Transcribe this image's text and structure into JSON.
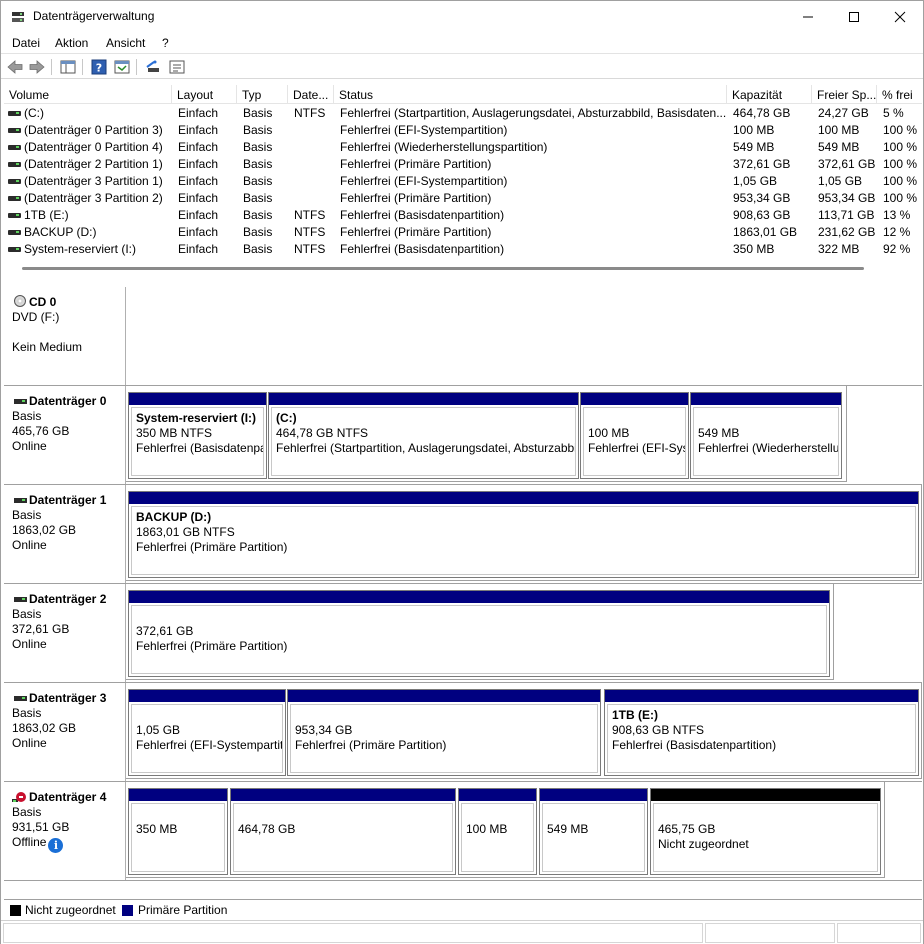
{
  "window": {
    "title": "Datenträgerverwaltung"
  },
  "menu": [
    {
      "label": "Datei"
    },
    {
      "label": "Aktion"
    },
    {
      "label": "Ansicht"
    },
    {
      "label": "?"
    }
  ],
  "toolbar": {
    "icons": [
      "back-arrow-icon",
      "forward-arrow-icon",
      "console-tree-icon",
      "help-icon",
      "action-pane-icon",
      "rescan-icon",
      "properties-icon"
    ]
  },
  "volume_table": {
    "headers": [
      "Volume",
      "Layout",
      "Typ",
      "Date...",
      "Status",
      "Kapazität",
      "Freier Sp...",
      "% frei"
    ],
    "rows": [
      {
        "volume": "(C:)",
        "layout": "Einfach",
        "typ": "Basis",
        "fs": "NTFS",
        "status": "Fehlerfrei (Startpartition, Auslagerungsdatei, Absturzabbild, Basisdaten...",
        "capacity": "464,78 GB",
        "free": "24,27 GB",
        "pct": "5 %"
      },
      {
        "volume": "(Datenträger 0 Partition 3)",
        "layout": "Einfach",
        "typ": "Basis",
        "fs": "",
        "status": "Fehlerfrei (EFI-Systempartition)",
        "capacity": "100 MB",
        "free": "100 MB",
        "pct": "100 %"
      },
      {
        "volume": "(Datenträger 0 Partition 4)",
        "layout": "Einfach",
        "typ": "Basis",
        "fs": "",
        "status": "Fehlerfrei (Wiederherstellungspartition)",
        "capacity": "549 MB",
        "free": "549 MB",
        "pct": "100 %"
      },
      {
        "volume": "(Datenträger 2 Partition 1)",
        "layout": "Einfach",
        "typ": "Basis",
        "fs": "",
        "status": "Fehlerfrei (Primäre Partition)",
        "capacity": "372,61 GB",
        "free": "372,61 GB",
        "pct": "100 %"
      },
      {
        "volume": "(Datenträger 3 Partition 1)",
        "layout": "Einfach",
        "typ": "Basis",
        "fs": "",
        "status": "Fehlerfrei (EFI-Systempartition)",
        "capacity": "1,05 GB",
        "free": "1,05 GB",
        "pct": "100 %"
      },
      {
        "volume": "(Datenträger 3 Partition 2)",
        "layout": "Einfach",
        "typ": "Basis",
        "fs": "",
        "status": "Fehlerfrei (Primäre Partition)",
        "capacity": "953,34 GB",
        "free": "953,34 GB",
        "pct": "100 %"
      },
      {
        "volume": "1TB (E:)",
        "layout": "Einfach",
        "typ": "Basis",
        "fs": "NTFS",
        "status": "Fehlerfrei (Basisdatenpartition)",
        "capacity": "908,63 GB",
        "free": "113,71 GB",
        "pct": "13 %"
      },
      {
        "volume": "BACKUP (D:)",
        "layout": "Einfach",
        "typ": "Basis",
        "fs": "NTFS",
        "status": "Fehlerfrei (Primäre Partition)",
        "capacity": "1863,01 GB",
        "free": "231,62 GB",
        "pct": "12 %"
      },
      {
        "volume": "System-reserviert (I:)",
        "layout": "Einfach",
        "typ": "Basis",
        "fs": "NTFS",
        "status": "Fehlerfrei (Basisdatenpartition)",
        "capacity": "350 MB",
        "free": "322 MB",
        "pct": "92 %"
      }
    ]
  },
  "disks": [
    {
      "name": "CD 0",
      "line1": "DVD (F:)",
      "line2": "",
      "line3": "Kein Medium",
      "icon": "cd-icon",
      "partitions": []
    },
    {
      "name": "Datenträger 0",
      "line1": "Basis",
      "line2": "465,76 GB",
      "line3": "Online",
      "icon": "disk-icon",
      "partitions": [
        {
          "title": "System-reserviert  (I:)",
          "size": "350 MB NTFS",
          "status": "Fehlerfrei (Basisdatenpa"
        },
        {
          "title": "(C:)",
          "size": "464,78 GB NTFS",
          "status": "Fehlerfrei (Startpartition, Auslagerungsdatei, Absturzabbi"
        },
        {
          "title": "",
          "size": "100 MB",
          "status": "Fehlerfrei (EFI-Sys"
        },
        {
          "title": "",
          "size": "549 MB",
          "status": "Fehlerfrei (Wiederherstellu"
        }
      ]
    },
    {
      "name": "Datenträger 1",
      "line1": "Basis",
      "line2": "1863,02 GB",
      "line3": "Online",
      "icon": "disk-icon",
      "partitions": [
        {
          "title": "BACKUP  (D:)",
          "size": "1863,01 GB NTFS",
          "status": "Fehlerfrei (Primäre Partition)"
        }
      ]
    },
    {
      "name": "Datenträger 2",
      "line1": "Basis",
      "line2": "372,61 GB",
      "line3": "Online",
      "icon": "disk-icon",
      "partitions": [
        {
          "title": "",
          "size": "372,61 GB",
          "status": "Fehlerfrei (Primäre Partition)"
        }
      ]
    },
    {
      "name": "Datenträger 3",
      "line1": "Basis",
      "line2": "1863,02 GB",
      "line3": "Online",
      "icon": "disk-icon",
      "partitions": [
        {
          "title": "",
          "size": "1,05 GB",
          "status": "Fehlerfrei (EFI-Systempartiti"
        },
        {
          "title": "",
          "size": "953,34 GB",
          "status": "Fehlerfrei (Primäre Partition)"
        },
        {
          "title": "1TB  (E:)",
          "size": "908,63 GB NTFS",
          "status": "Fehlerfrei (Basisdatenpartition)"
        }
      ]
    },
    {
      "name": "Datenträger 4",
      "line1": "Basis",
      "line2": "931,51 GB",
      "line3": "Offline",
      "icon": "offline-disk-icon",
      "partitions": [
        {
          "title": "",
          "size": "350 MB",
          "status": ""
        },
        {
          "title": "",
          "size": "464,78 GB",
          "status": ""
        },
        {
          "title": "",
          "size": "100 MB",
          "status": ""
        },
        {
          "title": "",
          "size": "549 MB",
          "status": ""
        },
        {
          "title": "",
          "size": "465,75 GB",
          "status": "Nicht zugeordnet"
        }
      ]
    }
  ],
  "legend": [
    {
      "label": "Nicht zugeordnet",
      "color": "#000000"
    },
    {
      "label": "Primäre Partition",
      "color": "#000080"
    }
  ]
}
